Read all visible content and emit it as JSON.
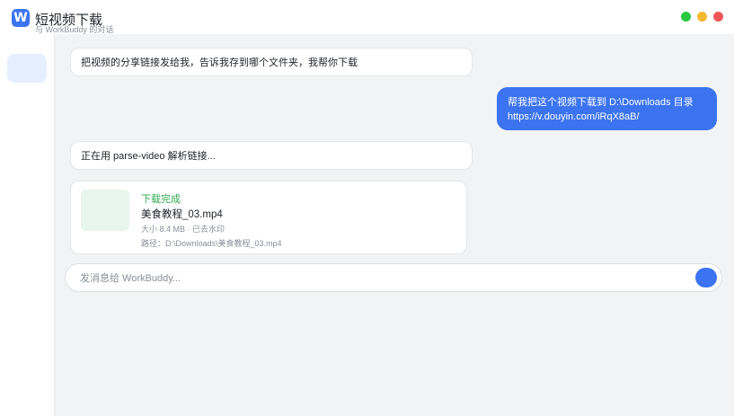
{
  "app": {
    "logo_letter": "W",
    "title": "短视频下载",
    "subtitle": "与 WorkBuddy 的对话"
  },
  "window_controls": [
    "green",
    "yellow",
    "red"
  ],
  "sidebar": {
    "top_icon": "",
    "items": [
      {
        "icon": "chat-icon",
        "glyph": "",
        "active": true
      },
      {
        "icon": "document-icon",
        "glyph": "",
        "active": false
      },
      {
        "icon": "folder-icon",
        "glyph": "",
        "active": false
      }
    ]
  },
  "messages": [
    {
      "role": "assistant",
      "text": "把视频的分享链接发给我，告诉我存到哪个文件夹，我帮你下载 "
    },
    {
      "role": "user",
      "line1": "帮我把这个视频下载到 D:\\Downloads 目录",
      "line2": "https://v.douyin.com/iRqX8aB/"
    },
    {
      "role": "assistant",
      "text": "正在用 parse-video 解析链接..."
    }
  ],
  "download_card": {
    "thumb_glyph": "",
    "status": " 下载完成",
    "filename": "美食教程_03.mp4",
    "meta": "大小 8.4 MB · 已去水印",
    "path": "路径：D:\\Downloads\\美食教程_03.mp4"
  },
  "composer": {
    "placeholder": "发消息给 WorkBuddy...",
    "send_glyph": ""
  },
  "colors": {
    "accent": "#3b73f0",
    "success": "#2fa84f",
    "background": "#f2f3f5"
  }
}
